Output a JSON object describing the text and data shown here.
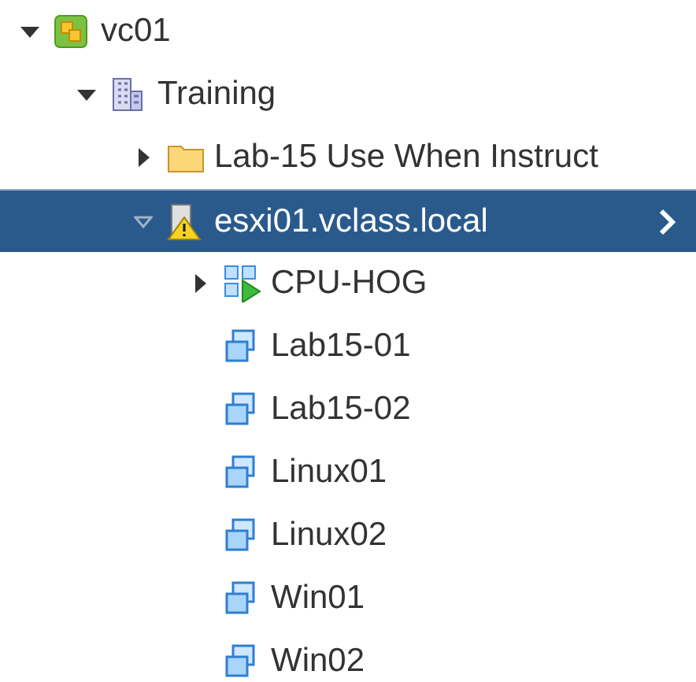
{
  "tree": [
    {
      "label": "vc01",
      "kind": "vcenter",
      "expanded": true,
      "selected": false,
      "children": [
        {
          "label": "Training",
          "kind": "datacenter",
          "expanded": true,
          "selected": false,
          "children": [
            {
              "label": "Lab-15 Use When Instruct",
              "kind": "folder",
              "expanded": false,
              "selected": false
            },
            {
              "label": "esxi01.vclass.local",
              "kind": "host-warning",
              "expanded": true,
              "selected": true,
              "children": [
                {
                  "label": "CPU-HOG",
                  "kind": "vapp",
                  "expanded": false,
                  "selected": false
                },
                {
                  "label": "Lab15-01",
                  "kind": "vm",
                  "selected": false
                },
                {
                  "label": "Lab15-02",
                  "kind": "vm",
                  "selected": false
                },
                {
                  "label": "Linux01",
                  "kind": "vm",
                  "selected": false
                },
                {
                  "label": "Linux02",
                  "kind": "vm",
                  "selected": false
                },
                {
                  "label": "Win01",
                  "kind": "vm",
                  "selected": false
                },
                {
                  "label": "Win02",
                  "kind": "vm",
                  "selected": false
                }
              ]
            }
          ]
        }
      ]
    }
  ]
}
